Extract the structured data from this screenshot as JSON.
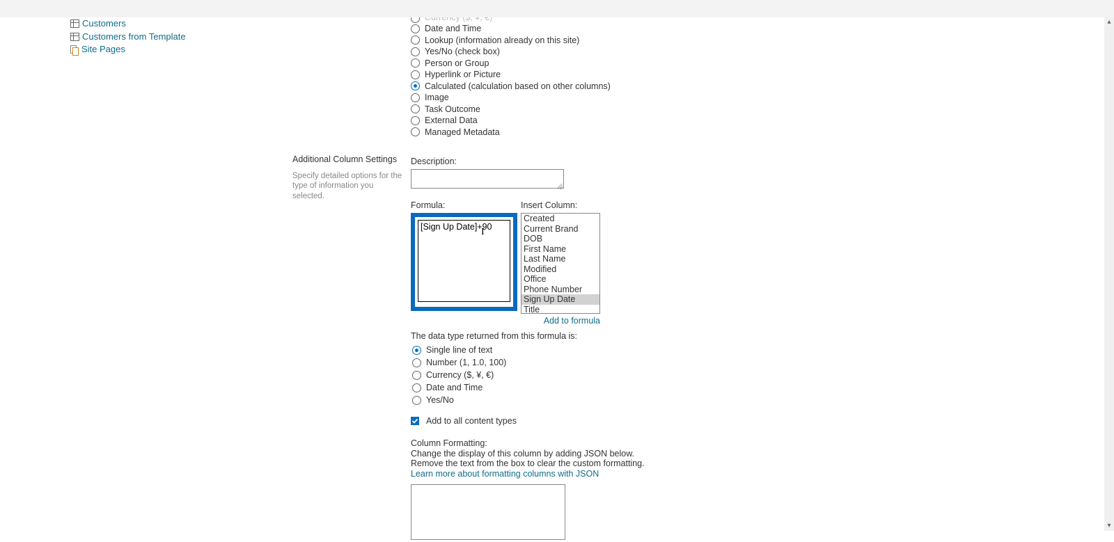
{
  "nav": {
    "items": [
      {
        "label": "Customers",
        "icon": "list"
      },
      {
        "label": "Customers from Template",
        "icon": "list"
      },
      {
        "label": "Site Pages",
        "icon": "page"
      }
    ]
  },
  "column_types": {
    "items": [
      {
        "label": "Currency ($, ¥, €)",
        "cropped": true
      },
      {
        "label": "Date and Time"
      },
      {
        "label": "Lookup (information already on this site)"
      },
      {
        "label": "Yes/No (check box)"
      },
      {
        "label": "Person or Group"
      },
      {
        "label": "Hyperlink or Picture"
      },
      {
        "label": "Calculated (calculation based on other columns)",
        "checked": true
      },
      {
        "label": "Image"
      },
      {
        "label": "Task Outcome"
      },
      {
        "label": "External Data"
      },
      {
        "label": "Managed Metadata"
      }
    ]
  },
  "settings_label": {
    "heading": "Additional Column Settings",
    "subtext": "Specify detailed options for the type of information you selected."
  },
  "controls": {
    "description_label": "Description:",
    "description_value": "",
    "formula_label": "Formula:",
    "formula_value": "[Sign Up Date]+90",
    "insert_column_label": "Insert Column:",
    "insert_column_items": [
      {
        "label": "Created"
      },
      {
        "label": "Current Brand"
      },
      {
        "label": "DOB"
      },
      {
        "label": "First Name"
      },
      {
        "label": "Last Name"
      },
      {
        "label": "Modified"
      },
      {
        "label": "Office"
      },
      {
        "label": "Phone Number"
      },
      {
        "label": "Sign Up Date",
        "selected": true
      },
      {
        "label": "Title"
      }
    ],
    "add_to_formula": "Add to formula"
  },
  "return_type": {
    "prompt": "The data type returned from this formula is:",
    "items": [
      {
        "label": "Single line of text",
        "checked": true
      },
      {
        "label": "Number (1, 1.0, 100)"
      },
      {
        "label": "Currency ($, ¥, €)"
      },
      {
        "label": "Date and Time"
      },
      {
        "label": "Yes/No"
      }
    ]
  },
  "add_all_ct": {
    "label": "Add to all content types",
    "checked": true
  },
  "column_formatting": {
    "heading": "Column Formatting:",
    "line1": "Change the display of this column by adding JSON below.",
    "line2": "Remove the text from the box to clear the custom formatting.",
    "link": "Learn more about formatting columns with JSON",
    "value": ""
  }
}
